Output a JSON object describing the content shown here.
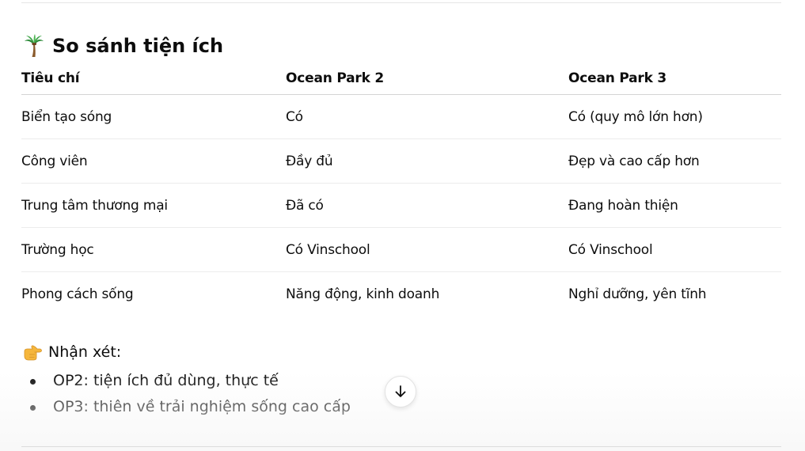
{
  "section": {
    "icon": "palm-tree-icon",
    "title": "So sánh tiện ích"
  },
  "table": {
    "headers": [
      "Tiêu chí",
      "Ocean Park 2",
      "Ocean Park 3"
    ],
    "rows": [
      [
        "Biển tạo sóng",
        "Có",
        "Có (quy mô lớn hơn)"
      ],
      [
        "Công viên",
        "Đầy đủ",
        "Đẹp và cao cấp hơn"
      ],
      [
        "Trung tâm thương mại",
        "Đã có",
        "Đang hoàn thiện"
      ],
      [
        "Trường học",
        "Có Vinschool",
        "Có Vinschool"
      ],
      [
        "Phong cách sống",
        "Năng động, kinh doanh",
        "Nghỉ dưỡng, yên tĩnh"
      ]
    ]
  },
  "remark": {
    "icon": "pointing-hand-icon",
    "title": "Nhận xét:",
    "items": [
      "OP2: tiện ích đủ dùng, thực tế",
      "OP3: thiên về trải nghiệm sống cao cấp"
    ]
  },
  "scroll_button": {
    "icon": "arrow-down-icon"
  },
  "colors": {
    "text": "#0d0d0d",
    "divider": "#ececec",
    "header_divider": "#d4d4d4"
  }
}
